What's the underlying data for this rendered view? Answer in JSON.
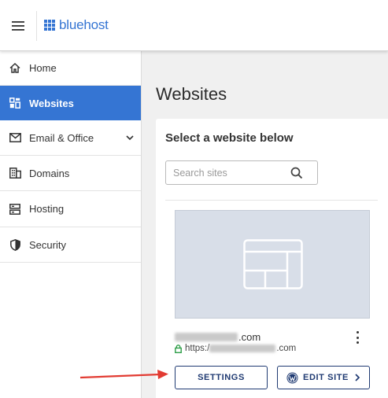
{
  "brand": {
    "name": "bluehost",
    "color": "#3575d3"
  },
  "colors": {
    "active_nav": "#3575d3",
    "button_border": "#1f3a72",
    "annotation_arrow": "#e23b32"
  },
  "topbar": {
    "menu_icon": "hamburger-icon"
  },
  "sidebar": {
    "items": [
      {
        "label": "Home",
        "icon": "home-icon",
        "active": false
      },
      {
        "label": "Websites",
        "icon": "websites-icon",
        "active": true
      },
      {
        "label": "Email & Office",
        "icon": "envelope-icon",
        "active": false,
        "expandable": true
      },
      {
        "label": "Domains",
        "icon": "building-icon",
        "active": false
      },
      {
        "label": "Hosting",
        "icon": "server-icon",
        "active": false
      },
      {
        "label": "Security",
        "icon": "shield-icon",
        "active": false
      }
    ]
  },
  "main": {
    "title": "Websites",
    "card_title": "Select a website below",
    "search": {
      "placeholder": "Search sites",
      "value": ""
    },
    "site": {
      "domain_suffix": ".com",
      "url_prefix": "https:/",
      "url_suffix": ".com",
      "settings_label": "SETTINGS",
      "edit_label": "EDIT SITE"
    }
  }
}
